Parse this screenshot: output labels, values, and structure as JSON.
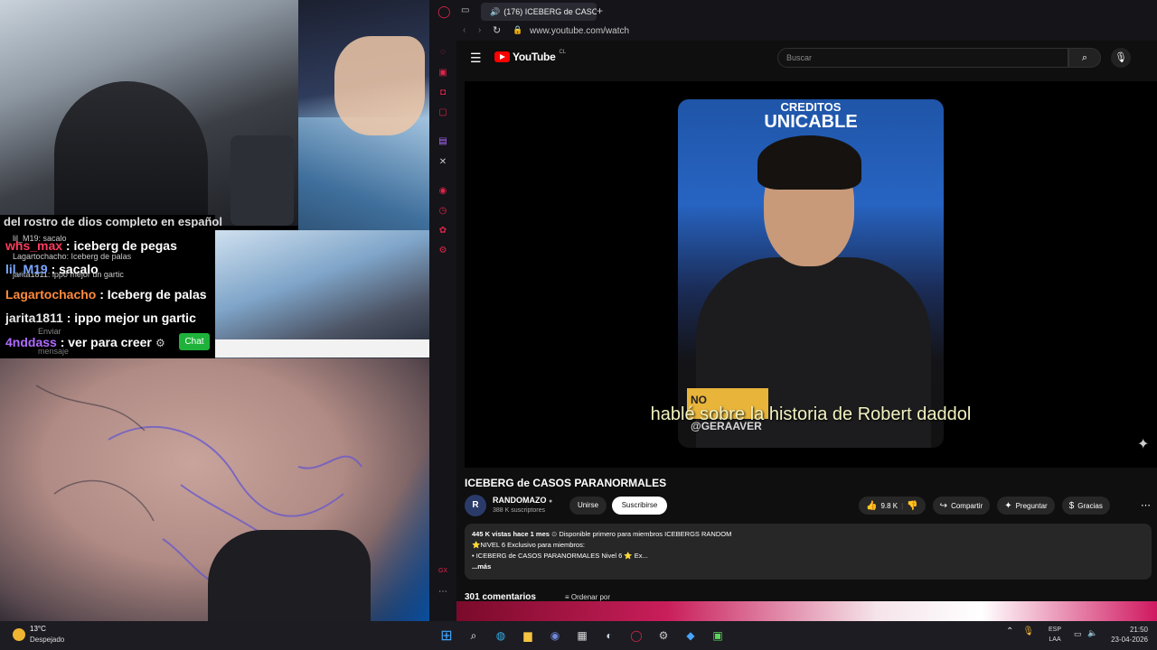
{
  "stream": {
    "chat": {
      "cut_line": "del rostro de dios completo en español",
      "small_lines": [
        {
          "user": "lil_M19",
          "text": ": sacalo"
        },
        {
          "user": "Lagartochacho",
          "text": ": Iceberg de palas"
        },
        {
          "user": "jarita1811",
          "text": ": ippo mejor un gartic"
        }
      ],
      "lines": [
        {
          "user": "whs_max",
          "text": " : iceberg de pegas",
          "color": "#ff3b5c"
        },
        {
          "user": "lil_M19",
          "text": " : sacalo",
          "color": "#7aa7ff"
        },
        {
          "user": "Lagartochacho",
          "text": " : Iceberg de palas",
          "color": "#ff8a3d"
        },
        {
          "user": "jarita1811",
          "text": " : ippo mejor un gartic",
          "color": "#e8e8e8"
        },
        {
          "user": "4nddass",
          "text": " : ver para creer",
          "color": "#b06bff"
        }
      ],
      "send_label": "Enviar",
      "message_label": "mensaje",
      "chat_button": "Chat"
    }
  },
  "browser": {
    "tab_title": "(176) ICEBERG de CASOS",
    "new_tab": "+",
    "url": "www.youtube.com/watch"
  },
  "youtube": {
    "logo_text": "YouTube",
    "region": "CL",
    "search_placeholder": "Buscar",
    "video": {
      "credits_line1": "CREDITOS",
      "credits_line2": "UNICABLE",
      "badge_text": "NO",
      "handle": "@GERAAVER",
      "subtitle": "hablé sobre la historia de Robert daddol",
      "title": "ICEBERG de CASOS PARANORMALES"
    },
    "channel": {
      "name": "RANDOMAZO",
      "subscribers": "388 K suscriptores",
      "join": "Unirse",
      "subscribe": "Suscribirse"
    },
    "actions": {
      "likes": "9.8 K",
      "share": "Compartir",
      "ask": "Preguntar",
      "thanks": "Gracias"
    },
    "description": {
      "views": "445 K vistas",
      "date": "hace 1 mes",
      "members_first": "Disponible primero para miembros",
      "playlist": "ICEBERGS RANDOM",
      "line2": "⭐NIVEL 6 Exclusivo para miembros:",
      "line3": "• ICEBERG de CASOS PARANORMALES Nivel 6 ⭐ Ex...",
      "more": "...más"
    },
    "comments_count": "301 comentarios",
    "sort_label": "Ordenar por"
  },
  "taskbar": {
    "temperature": "13°C",
    "weather": "Despejado",
    "lang_line1": "ESP",
    "lang_line2": "LAA",
    "time": "21:50",
    "date": "23-04-2026"
  },
  "colors": {
    "accent_red": "#ff0000",
    "opera_red": "#e0254a",
    "chat_green": "#1fb23a"
  }
}
